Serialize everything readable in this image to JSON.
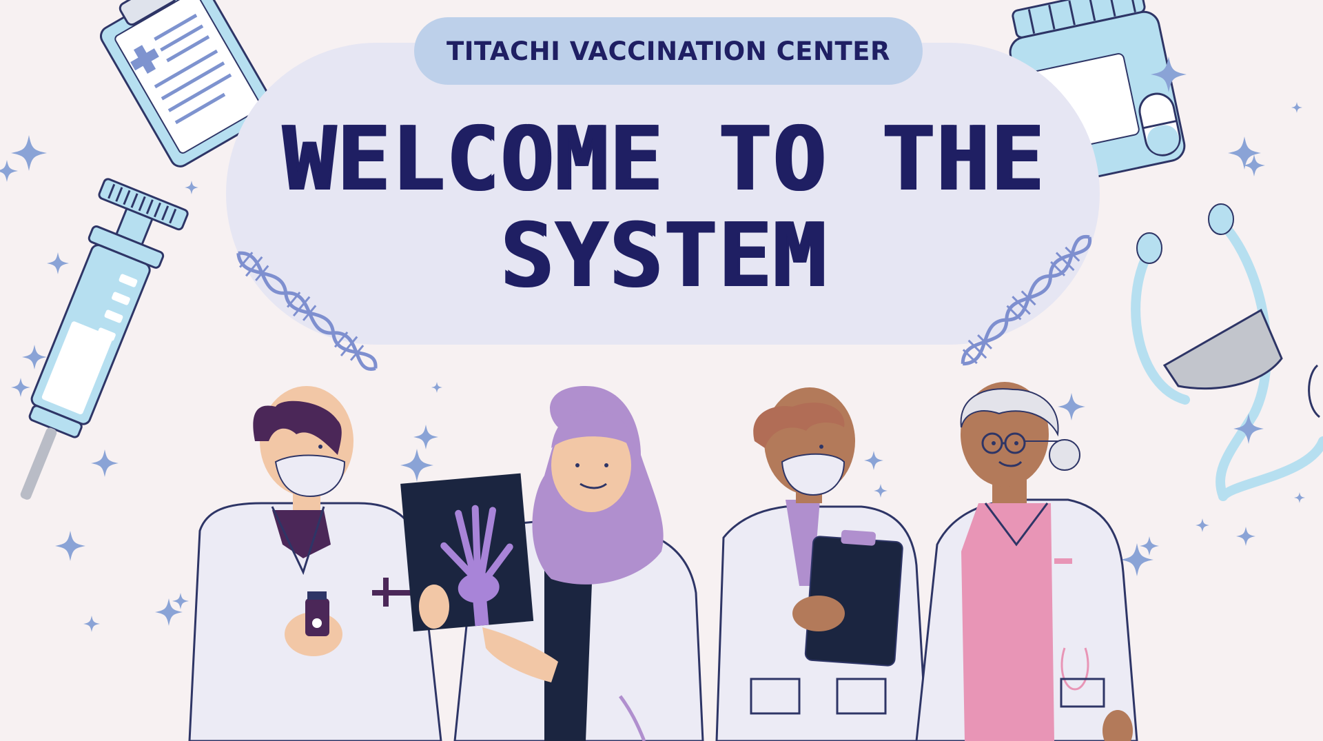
{
  "header": {
    "center_name": "TITACHI VACCINATION CENTER"
  },
  "hero": {
    "title_line_1": "WELCOME TO THE",
    "title_line_2": "SYSTEM"
  },
  "icons": {
    "clipboard": "clipboard-icon",
    "syringe": "syringe-icon",
    "pill_bottle": "pill-bottle-icon",
    "stethoscope": "stethoscope-icon",
    "dna": "dna-icon",
    "sparkle": "sparkle-icon"
  },
  "colors": {
    "background": "#f7f1f2",
    "bubble": "#e6e6f3",
    "pill": "#bdd0ea",
    "title": "#1f1f63",
    "accent_blue": "#b6dff0",
    "accent_purple": "#b08fce",
    "accent_pink": "#e895b6",
    "coat": "#ecebf5"
  }
}
